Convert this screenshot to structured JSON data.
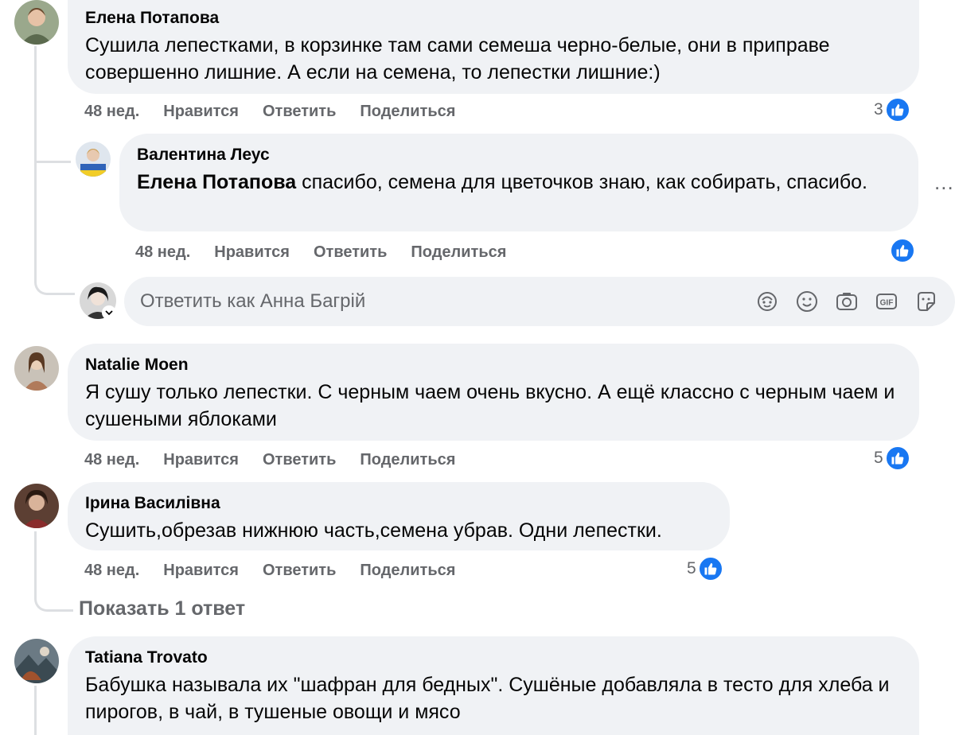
{
  "comments": [
    {
      "author": "Елена Потапова",
      "text": "Сушила лепестками, в корзинке там сами семеша черно-белые, они в приправе совершенно лишние. А если на семена, то лепестки лишние:)",
      "time": "48 нед.",
      "like_label": "Нравится",
      "reply_label": "Ответить",
      "share_label": "Поделиться",
      "reactions": "3"
    },
    {
      "author": "Валентина Леус",
      "mention": "Елена Потапова",
      "text": " спасибо, семена для цветочков знаю, как собирать, спасибо.",
      "time": "48 нед.",
      "like_label": "Нравится",
      "reply_label": "Ответить",
      "share_label": "Поделиться",
      "reactions": ""
    },
    {
      "author": "Natalie Moen",
      "text": "Я сушу только лепестки. С черным чаем очень вкусно. А ещё классно с черным чаем и сушеными яблоками",
      "time": "48 нед.",
      "like_label": "Нравится",
      "reply_label": "Ответить",
      "share_label": "Поделиться",
      "reactions": "5"
    },
    {
      "author": "Ірина Василівна",
      "text": "Сушить,обрезав нижнюю часть,семена убрав. Одни лепестки.",
      "time": "48 нед.",
      "like_label": "Нравится",
      "reply_label": "Ответить",
      "share_label": "Поделиться",
      "reactions": "5"
    },
    {
      "author": "Tatiana Trovato",
      "text": "Бабушка называла их \"шафран для бедных\". Сушёные добавляла в тесто для хлеба и пирогов, в чай, в тушеные овощи и мясо"
    }
  ],
  "reply_box": {
    "placeholder": "Ответить как Анна Багрій",
    "icons": [
      "avatar-sticker-icon",
      "emoji-icon",
      "camera-icon",
      "gif-icon",
      "sticker-icon"
    ]
  },
  "show_replies": "Показать 1 ответ",
  "more_options": "...",
  "colors": {
    "bubble": "#f0f2f5",
    "meta": "#65676b",
    "like_blue": "#1877f2",
    "thread": "#dddfe2"
  }
}
